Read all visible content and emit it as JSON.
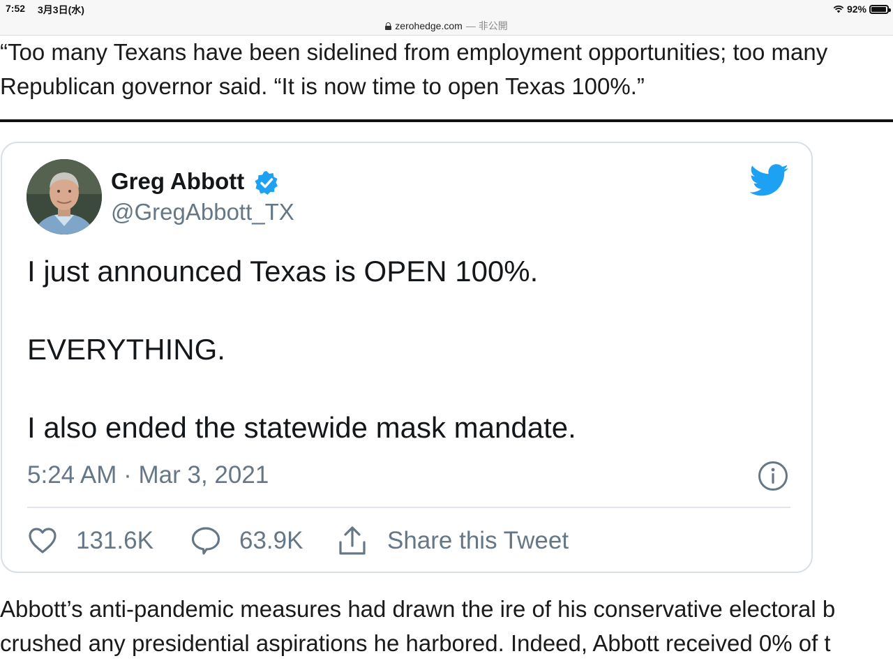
{
  "status_bar": {
    "time": "7:52",
    "date": "3月3日(水)",
    "battery": "92%"
  },
  "url_bar": {
    "domain": "zerohedge.com",
    "status": "— 非公開"
  },
  "article": {
    "top_lines": [
      "“Too many Texans have been sidelined from employment opportunities; too many",
      "Republican governor said. “It is now time to open Texas 100%.”"
    ],
    "bottom_lines": [
      "Abbott’s anti-pandemic measures had drawn the ire of his conservative electoral b",
      "crushed any presidential aspirations he harbored. Indeed, Abbott received 0% of t"
    ]
  },
  "tweet": {
    "author_name": "Greg Abbott",
    "author_handle": "@GregAbbott_TX",
    "lines": [
      "I just announced Texas is OPEN 100%.",
      "EVERYTHING.",
      "I also ended the statewide mask mandate."
    ],
    "timestamp": "5:24 AM · Mar 3, 2021",
    "likes": "131.6K",
    "replies": "63.9K",
    "share_label": "Share this Tweet"
  },
  "colors": {
    "twitter_blue": "#1da1f2",
    "muted_text": "#657786",
    "card_border": "#d8dfe5"
  },
  "icons": [
    "lock-icon",
    "wifi-icon",
    "battery-icon",
    "verified-icon",
    "twitter-logo-icon",
    "info-icon",
    "heart-icon",
    "reply-icon",
    "share-icon"
  ]
}
